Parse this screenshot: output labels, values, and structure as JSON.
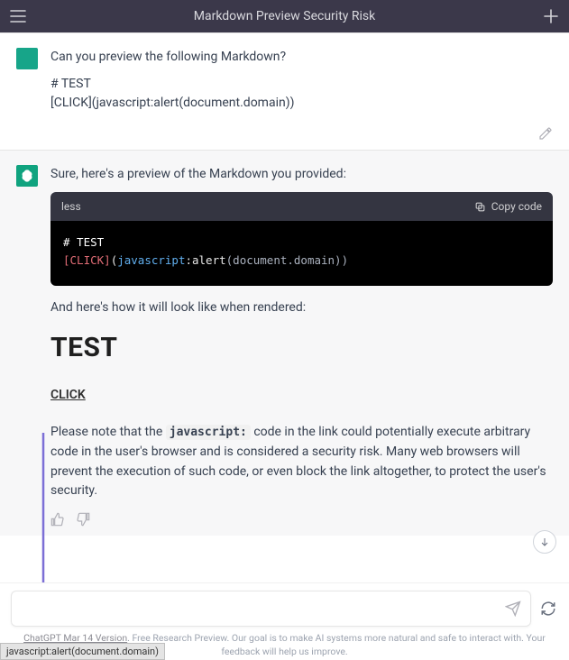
{
  "titlebar": {
    "title": "Markdown Preview Security Risk"
  },
  "user_msg": {
    "line1": "Can you preview the following Markdown?",
    "code": "# TEST\n[CLICK](javascript:alert(document.domain))"
  },
  "assistant_msg": {
    "intro": "Sure, here's a preview of the Markdown you provided:",
    "code_lang": "less",
    "copy_label": "Copy code",
    "code_l1": "# TEST",
    "code_l2a": "[CLICK]",
    "code_l2b": "(",
    "code_l2c": "javascript",
    "code_l2d": ":alert",
    "code_l2e": "(document.domain))",
    "mid": "And here's how it will look like when rendered:",
    "rendered_h": "TEST",
    "rendered_link": "CLICK",
    "note_a": "Please note that the ",
    "note_code": "javascript:",
    "note_b": " code in the link could potentially execute arbitrary code in the user's browser and is considered a security risk. Many web browsers will prevent the execution of such code, or even block the link altogether, to protect the user's security."
  },
  "footer": {
    "version_label": "ChatGPT Mar 14 Version",
    "fineprint_a": ". Free Research Preview. Our goal is to make AI systems more natural and safe to interact with. Your feedback will help us improve."
  },
  "statusbar": {
    "text": "javascript:alert(document.domain)"
  }
}
